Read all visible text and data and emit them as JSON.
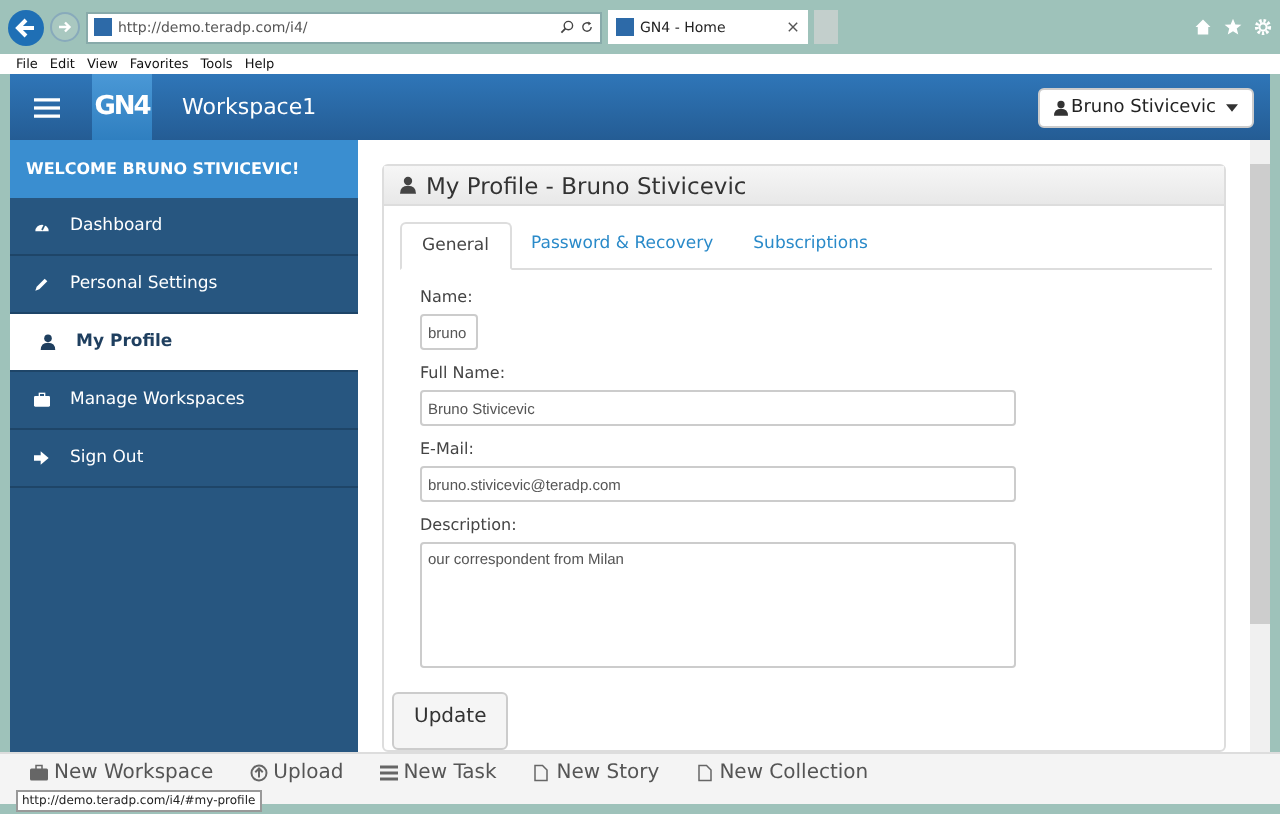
{
  "browser": {
    "address": "http://demo.teradp.com/i4/",
    "tab_title": "GN4 - Home",
    "menu": [
      "File",
      "Edit",
      "View",
      "Favorites",
      "Tools",
      "Help"
    ]
  },
  "header": {
    "logo": "GN4",
    "workspace": "Workspace1",
    "user": "Bruno Stivicevic"
  },
  "sidebar": {
    "welcome": "WELCOME BRUNO STIVICEVIC!",
    "items": [
      {
        "label": "Dashboard",
        "selected": false
      },
      {
        "label": "Personal Settings",
        "selected": false
      },
      {
        "label": "My Profile",
        "selected": true
      },
      {
        "label": "Manage Workspaces",
        "selected": false
      },
      {
        "label": "Sign Out",
        "selected": false
      }
    ]
  },
  "panel": {
    "title": "My Profile - Bruno Stivicevic",
    "tabs": [
      {
        "label": "General",
        "selected": true
      },
      {
        "label": "Password & Recovery",
        "selected": false
      },
      {
        "label": "Subscriptions",
        "selected": false
      }
    ],
    "fields": [
      {
        "label": "Name:",
        "value": "bruno",
        "kind": "short"
      },
      {
        "label": "Full Name:",
        "value": "Bruno Stivicevic",
        "kind": "input"
      },
      {
        "label": "E-Mail:",
        "value": "bruno.stivicevic@teradp.com",
        "kind": "input"
      },
      {
        "label": "Description:",
        "value": "our correspondent from Milan",
        "kind": "textarea"
      }
    ],
    "button": "Update"
  },
  "bottom_bar": [
    {
      "label": "New Workspace"
    },
    {
      "label": "Upload"
    },
    {
      "label": "New Task"
    },
    {
      "label": "New Story"
    },
    {
      "label": "New Collection"
    }
  ],
  "status_tooltip": "http://demo.teradp.com/i4/#my-profile"
}
